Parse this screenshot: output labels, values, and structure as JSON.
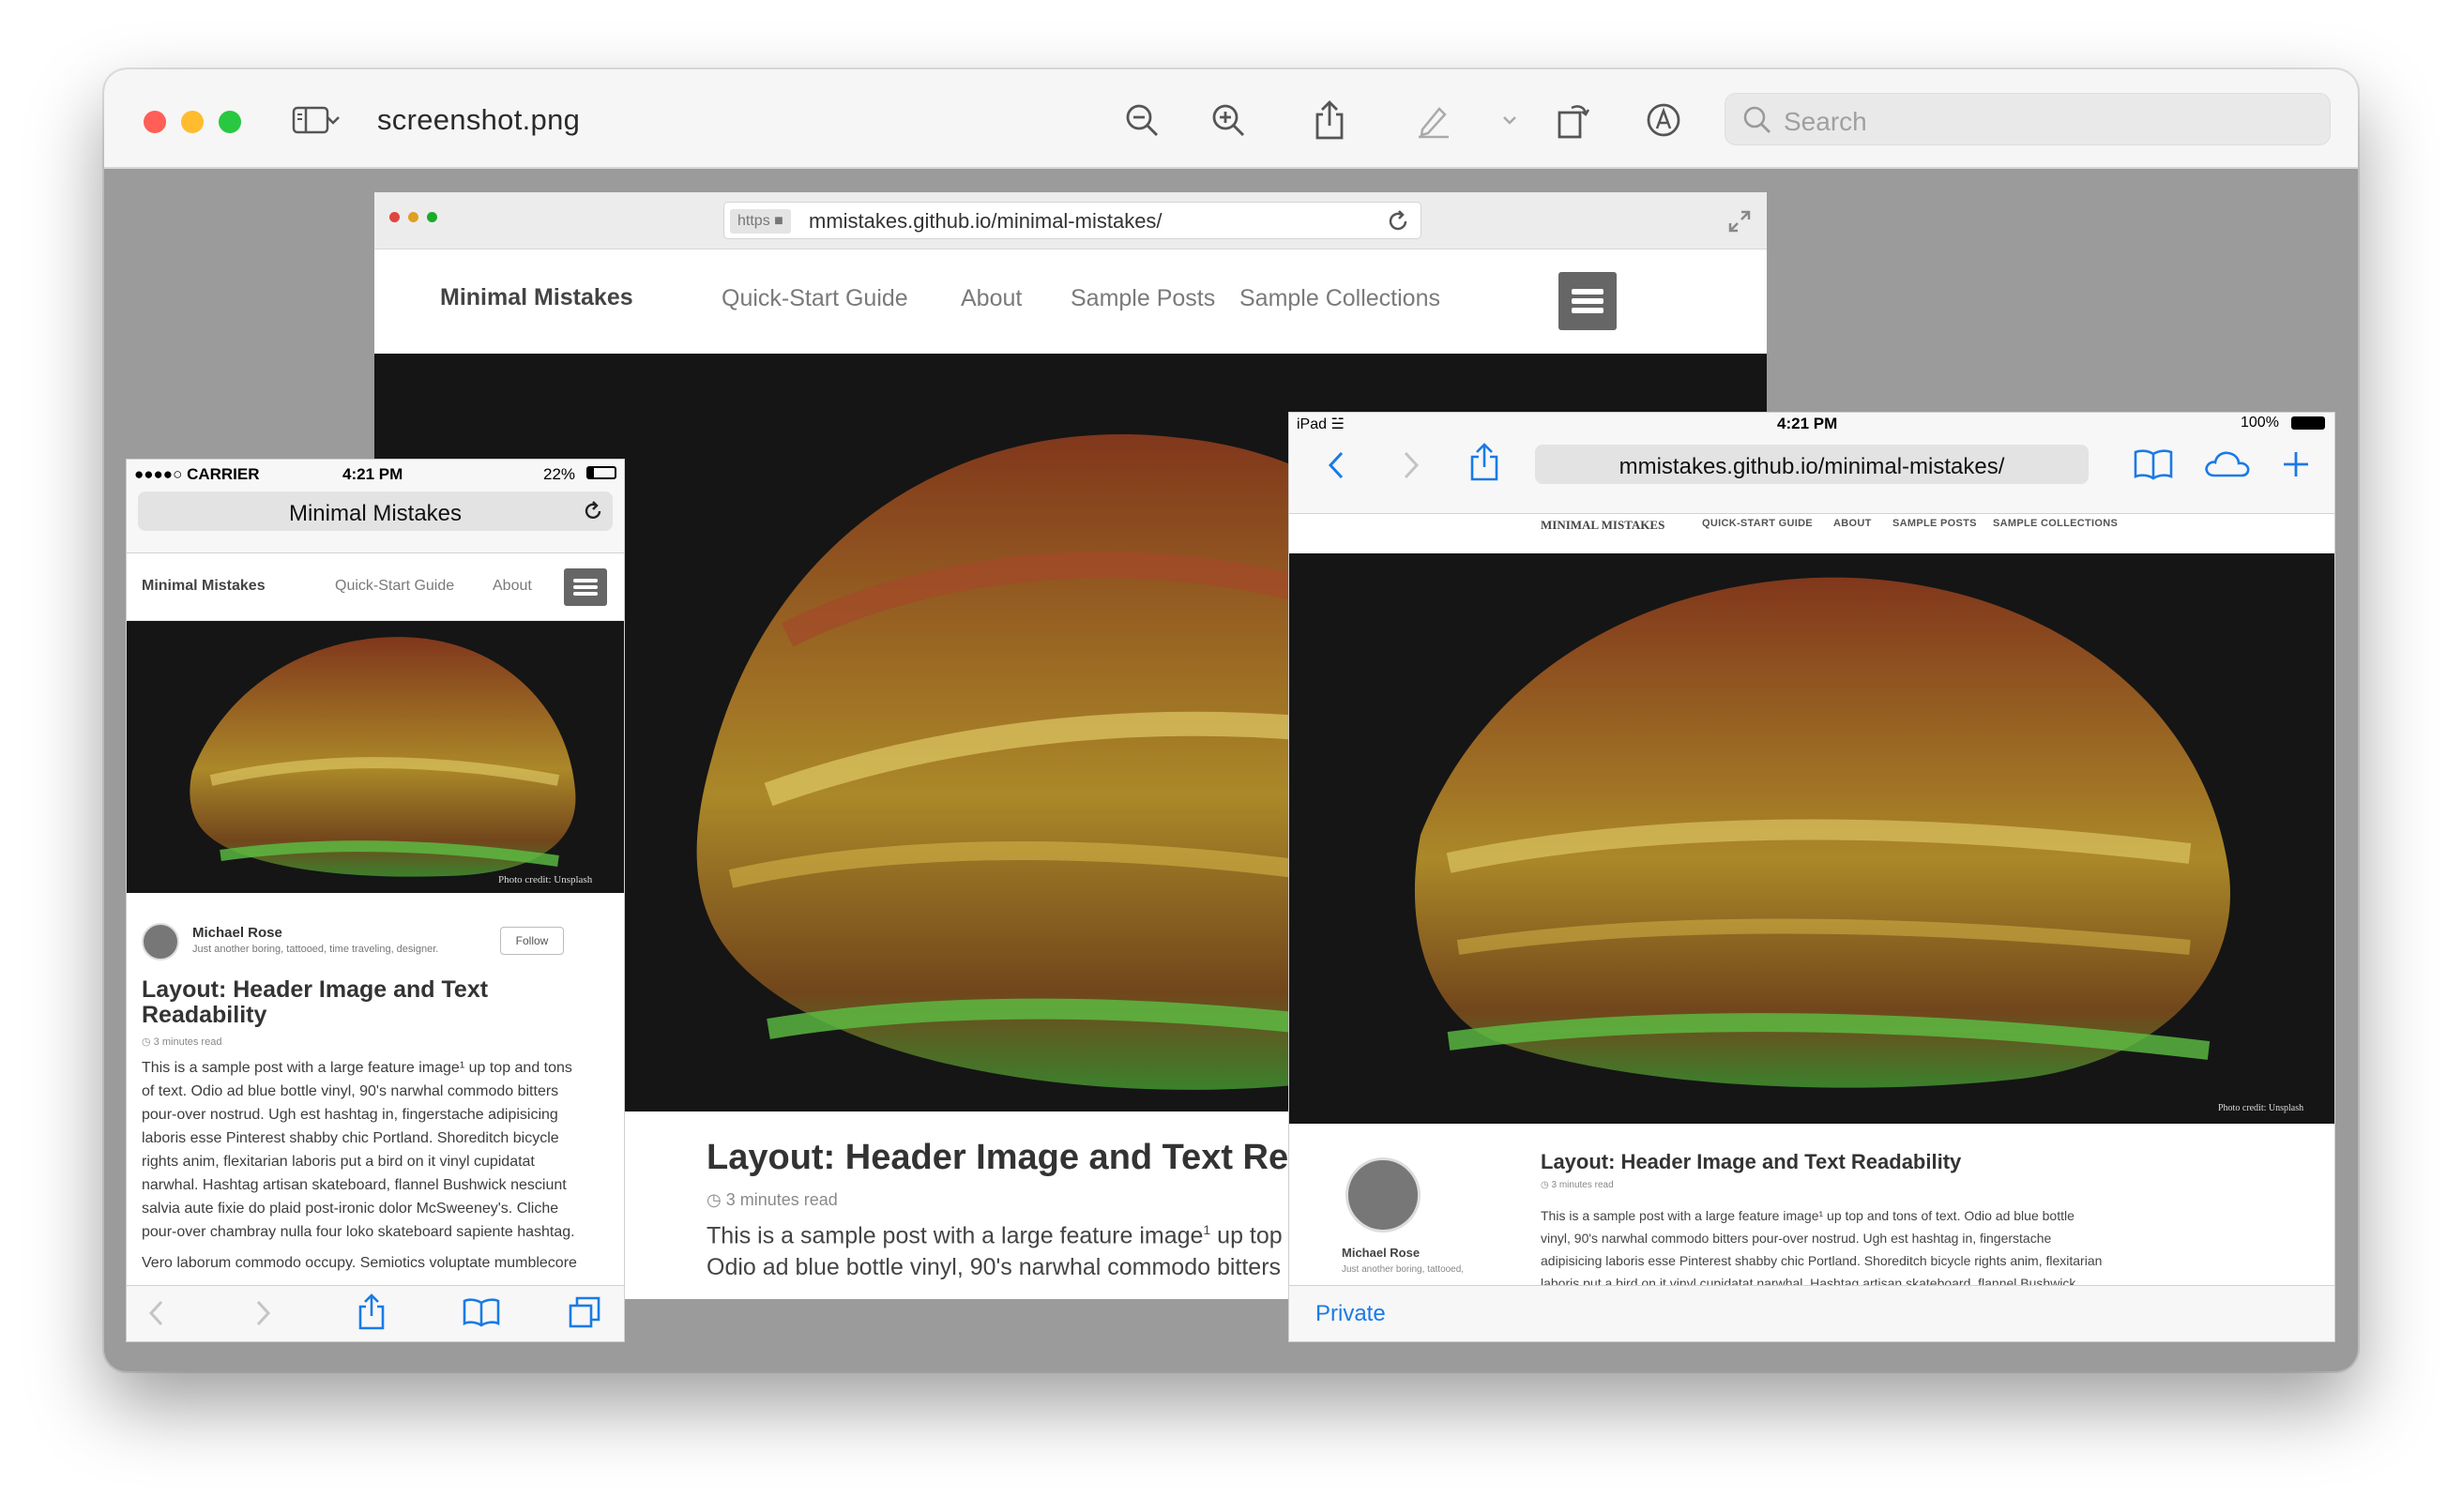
{
  "window": {
    "file_title": "screenshot.png",
    "search_placeholder": "Search",
    "toolbar_icons": [
      "sidebar-toggle-icon",
      "chevron-down-icon",
      "zoom-out-icon",
      "zoom-in-icon",
      "share-icon",
      "markup-pen-icon",
      "chevron-down-icon",
      "rotate-icon",
      "annotate-icon",
      "search-icon"
    ],
    "colors": {
      "close": "#ff5f57",
      "minimize": "#febc2e",
      "maximize": "#28c840",
      "canvas": "#9b9b9b"
    }
  },
  "desktop": {
    "https_badge": "https",
    "url": "mmistakes.github.io/minimal-mistakes/",
    "site_title": "Minimal Mistakes",
    "nav": [
      "Quick-Start Guide",
      "About",
      "Sample Posts",
      "Sample Collections"
    ],
    "post_title": "Layout: Header Image and Text Re",
    "read_time": "3 minutes read",
    "body_line1": "This is a sample post with a large feature image",
    "body_line1_sup": "1",
    "body_line1_tail": " up top a",
    "body_line2": "Odio ad blue bottle vinyl, 90's narwhal commodo bitters"
  },
  "phone": {
    "carrier": "●●●●○ CARRIER",
    "time": "4:21 PM",
    "battery": "22%",
    "address_title": "Minimal Mistakes",
    "site_title": "Minimal Mistakes",
    "nav": [
      "Quick-Start Guide",
      "About"
    ],
    "photo_credit": "Photo credit: Unsplash",
    "author_name": "Michael Rose",
    "author_bio": "Just another boring, tattooed, time traveling, designer.",
    "follow_label": "Follow",
    "post_title": "Layout: Header Image and Text Readability",
    "read_time": "3 minutes read",
    "paragraph": [
      "This is a sample post with a large feature image¹ up top and tons",
      "of text. Odio ad blue bottle vinyl, 90's narwhal commodo bitters",
      "pour-over nostrud. Ugh est hashtag in, fingerstache adipisicing",
      "laboris esse Pinterest shabby chic Portland. Shoreditch bicycle",
      "rights anim, flexitarian laboris put a bird on it vinyl cupidatat",
      "narwhal. Hashtag artisan skateboard, flannel Bushwick nesciunt",
      "salvia aute fixie do plaid post-ironic dolor McSweeney's. Cliche",
      "pour-over chambray nulla four loko skateboard sapiente hashtag."
    ],
    "paragraph2": "Vero laborum commodo occupy. Semiotics voluptate mumblecore"
  },
  "tablet": {
    "device": "iPad",
    "time": "4:21 PM",
    "battery": "100%",
    "url": "mmistakes.github.io/minimal-mistakes/",
    "site_title": "MINIMAL MISTAKES",
    "nav": [
      "QUICK-START GUIDE",
      "ABOUT",
      "SAMPLE POSTS",
      "SAMPLE COLLECTIONS"
    ],
    "photo_credit": "Photo credit: Unsplash",
    "author_name": "Michael Rose",
    "author_bio": "Just another boring, tattooed,",
    "post_title": "Layout: Header Image and Text Readability",
    "read_time": "3 minutes read",
    "paragraph": [
      "This is a sample post with a large feature image¹ up top and tons of text. Odio ad blue bottle",
      "vinyl, 90's narwhal commodo bitters pour-over nostrud. Ugh est hashtag in, fingerstache",
      "adipisicing laboris esse Pinterest shabby chic Portland. Shoreditch bicycle rights anim, flexitarian",
      "laboris put a bird on it vinyl cupidatat narwhal. Hashtag artisan skateboard, flannel Bushwick"
    ],
    "private_label": "Private"
  }
}
